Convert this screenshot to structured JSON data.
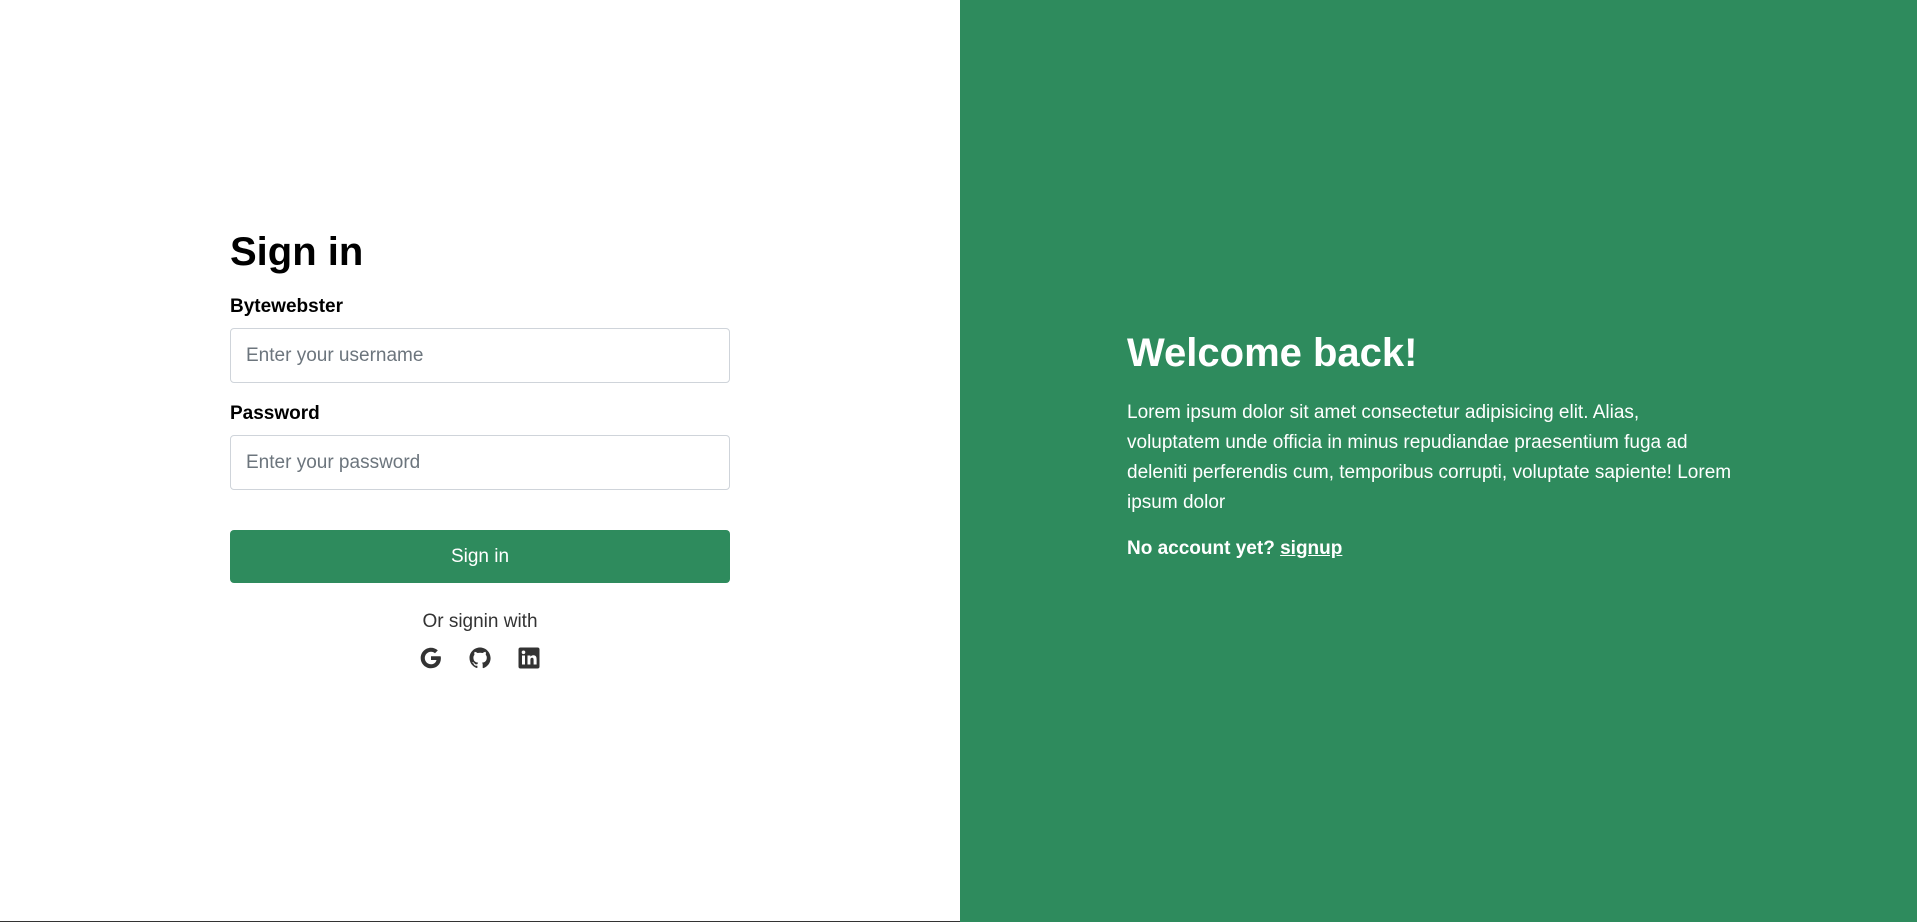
{
  "signin": {
    "title": "Sign in",
    "username_label": "Bytewebster",
    "username_placeholder": "Enter your username",
    "username_value": "",
    "password_label": "Password",
    "password_placeholder": "Enter your password",
    "password_value": "",
    "submit_label": "Sign in",
    "alt_text": "Or signin with",
    "socials": [
      "google-icon",
      "github-icon",
      "linkedin-icon"
    ]
  },
  "welcome": {
    "title": "Welcome back!",
    "text": "Lorem ipsum dolor sit amet consectetur adipisicing elit. Alias, voluptatem unde officia in minus repudiandae praesentium fuga ad deleniti perferendis cum, temporibus corrupti, voluptate sapiente! Lorem ipsum dolor",
    "no_account": "No account yet?",
    "signup_link": "signup"
  },
  "colors": {
    "accent": "#2e8b5d",
    "text": "#000000",
    "icon": "#333333"
  }
}
